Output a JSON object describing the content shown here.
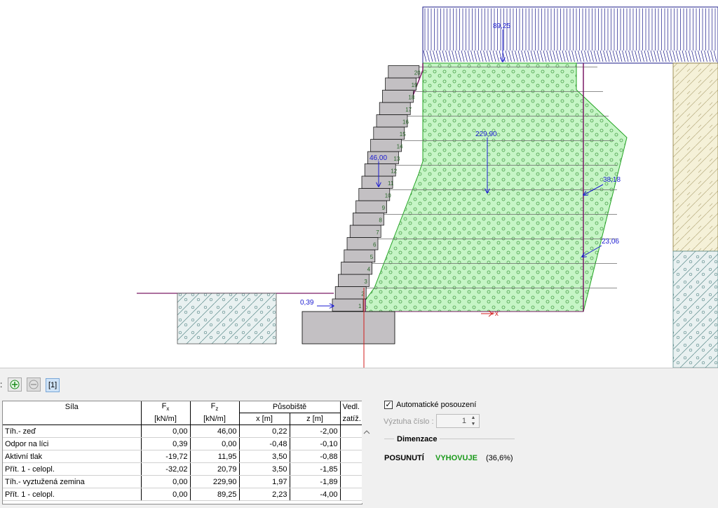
{
  "drawing": {
    "load_top_value": "89,25",
    "force_wall_value": "46,00",
    "force_soil_value": "229,90",
    "force_active1_value": "38,18",
    "force_active2_value": "23,06",
    "force_face_value": "0,39",
    "axis_x_label": "+x",
    "layer_numbers": [
      "1",
      "2",
      "3",
      "4",
      "5",
      "6",
      "7",
      "8",
      "9",
      "10",
      "11",
      "12",
      "13",
      "14",
      "15",
      "16",
      "17",
      "18",
      "19",
      "20"
    ],
    "colors": {
      "reinforced_fill": "#c6f5c6",
      "reinforced_edge": "#22a322",
      "block_fill": "#c3c0c3",
      "wall_line": "#7a1a66",
      "force": "#1b1bd1",
      "axis": "#d11b1b",
      "soil_right_upper": "#f5f1d8",
      "soil_blue": "#e9f1f1"
    }
  },
  "toolbar": {
    "colon": ":",
    "add_icon": "plus-icon",
    "remove_icon": "minus-icon",
    "tab_label": "[1]"
  },
  "table": {
    "header_row1": [
      "Síla",
      "F",
      "F",
      "Působiště",
      "Vedl."
    ],
    "fx_sub": "x",
    "fz_sub": "z",
    "header_row2": [
      "",
      "[kN/m]",
      "[kN/m]",
      "x [m]",
      "z [m]",
      "zatíž."
    ],
    "rows": [
      {
        "name": "Tíh.- zeď",
        "fx": "0,00",
        "fz": "46,00",
        "x": "0,22",
        "z": "-2,00",
        "side": ""
      },
      {
        "name": "Odpor na líci",
        "fx": "0,39",
        "fz": "0,00",
        "x": "-0,48",
        "z": "-0,10",
        "side": ""
      },
      {
        "name": "Aktivní tlak",
        "fx": "-19,72",
        "fz": "11,95",
        "x": "3,50",
        "z": "-0,88",
        "side": ""
      },
      {
        "name": "Přít. 1 - celopl.",
        "fx": "-32,02",
        "fz": "20,79",
        "x": "3,50",
        "z": "-1,85",
        "side": ""
      },
      {
        "name": "Tíh.- vyztužená zemina",
        "fx": "0,00",
        "fz": "229,90",
        "x": "1,97",
        "z": "-1,89",
        "side": ""
      },
      {
        "name": "Přít. 1 - celopl.",
        "fx": "0,00",
        "fz": "89,25",
        "x": "2,23",
        "z": "-4,00",
        "side": ""
      }
    ]
  },
  "panel": {
    "auto_label": "Automatické posouzení",
    "auto_checked": true,
    "vyztuha_label": "Výztuha číslo :",
    "vyztuha_value": "1",
    "dimenzace": "Dimenzace",
    "result_label": "POSUNUTÍ",
    "result_status": "VYHOVUJE",
    "result_pct": "(36,6%)"
  }
}
